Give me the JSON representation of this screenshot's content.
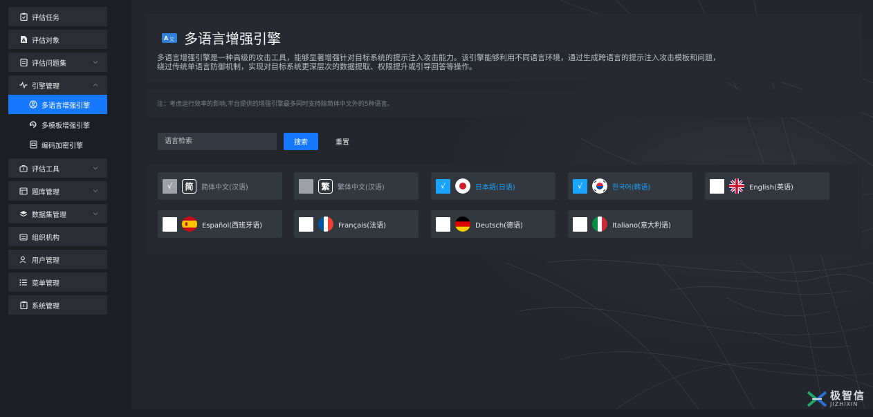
{
  "sidebar": {
    "items": [
      {
        "label": "评估任务",
        "icon": "clipboard-icon"
      },
      {
        "label": "评估对象",
        "icon": "document-icon"
      },
      {
        "label": "评估问题集",
        "icon": "list-icon"
      },
      {
        "label": "引擎管理",
        "icon": "engine-icon"
      }
    ],
    "engine_sub": [
      {
        "label": "多语言增强引擎",
        "icon": "language-icon"
      },
      {
        "label": "多模板增强引擎",
        "icon": "template-icon"
      },
      {
        "label": "编码加密引擎",
        "icon": "encode-icon"
      }
    ],
    "items_after": [
      {
        "label": "评估工具",
        "icon": "tools-icon"
      },
      {
        "label": "题库管理",
        "icon": "question-bank-icon"
      },
      {
        "label": "数据集管理",
        "icon": "dataset-icon"
      },
      {
        "label": "组织机构",
        "icon": "organization-icon"
      },
      {
        "label": "用户管理",
        "icon": "user-icon"
      },
      {
        "label": "菜单管理",
        "icon": "menu-icon"
      },
      {
        "label": "系统管理",
        "icon": "system-icon"
      }
    ]
  },
  "header": {
    "title": "多语言增强引擎",
    "description": "多语言增强引擎是一种高级的攻击工具，能够显著增强针对目标系统的提示注入攻击能力。该引擎能够利用不同语言环境，通过生成跨语言的提示注入攻击模板和问题，绕过传统单语言防御机制，实现对目标系统更深层次的数据提取、权限提升或引导回答等操作。"
  },
  "note": "注：考虑运行效率的影响,平台提供的增强引擎最多同时支持除简体中文外的5种语言。",
  "search": {
    "placeholder": "语言检索",
    "search_label": "搜索",
    "reset_label": "重置"
  },
  "languages": [
    {
      "label": "简体中文(汉语)",
      "glyph": "简",
      "state": "disabled"
    },
    {
      "label": "繁体中文(汉语)",
      "glyph": "繁",
      "state": "disabled"
    },
    {
      "label": "日本語(日语)",
      "flag": "japan-flag",
      "state": "checked"
    },
    {
      "label": "한국어(韩语)",
      "flag": "korea-flag",
      "state": "checked"
    },
    {
      "label": "English(英语)",
      "flag": "uk-flag",
      "state": "unchecked"
    },
    {
      "label": "Español(西班牙语)",
      "flag": "spain-flag",
      "state": "unchecked"
    },
    {
      "label": "Français(法语)",
      "flag": "france-flag",
      "state": "unchecked"
    },
    {
      "label": "Deutsch(德语)",
      "flag": "germany-flag",
      "state": "unchecked"
    },
    {
      "label": "Italiano(意大利语)",
      "flag": "italy-flag",
      "state": "unchecked"
    }
  ],
  "check_mark": "√",
  "logo": {
    "zh": "极智信",
    "en": "JIZHIXIN"
  },
  "colors": {
    "accent": "#1677ff",
    "checked": "#1aa3ff",
    "sidebar": "#2a2d33"
  }
}
